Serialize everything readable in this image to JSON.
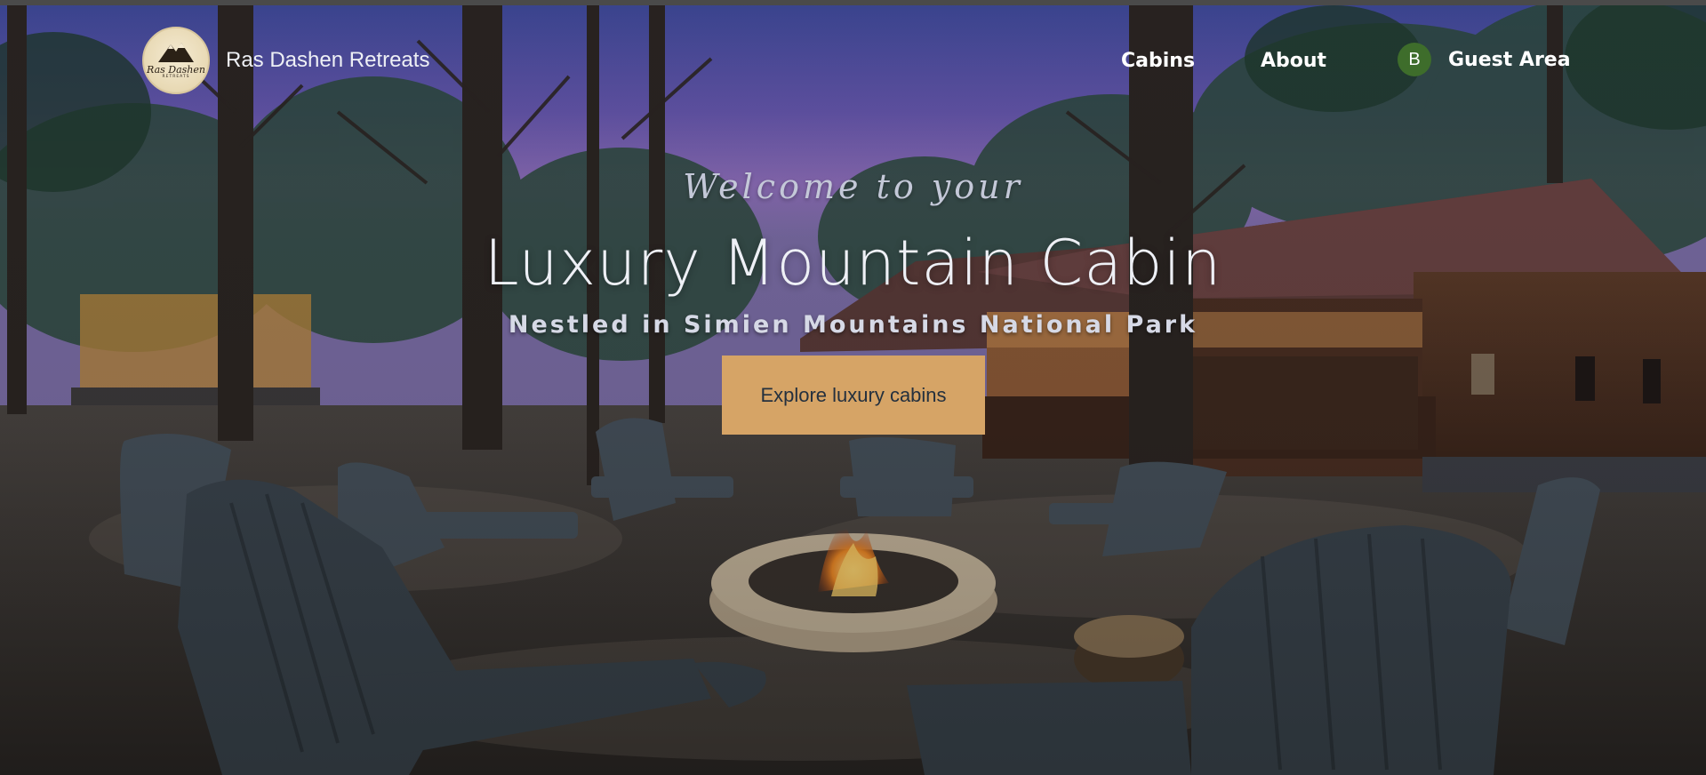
{
  "brand": {
    "name": "Ras Dashen Retreats",
    "logo_text": "Ras Dashen",
    "logo_subtext": "RETREATS"
  },
  "nav": {
    "cabins": "Cabins",
    "about": "About"
  },
  "guest": {
    "avatar_initial": "B",
    "label": "Guest Area"
  },
  "hero": {
    "welcome": "Welcome to your",
    "title": "Luxury Mountain Cabin",
    "subtitle": "Nestled in Simien Mountains National Park",
    "cta_label": "Explore luxury cabins"
  },
  "colors": {
    "cta_background": "#d6a466",
    "cta_text": "#24303e",
    "avatar_background": "#3e6d2b",
    "sky_top": "#3f4a9a",
    "sky_mid": "#7a63b4"
  }
}
